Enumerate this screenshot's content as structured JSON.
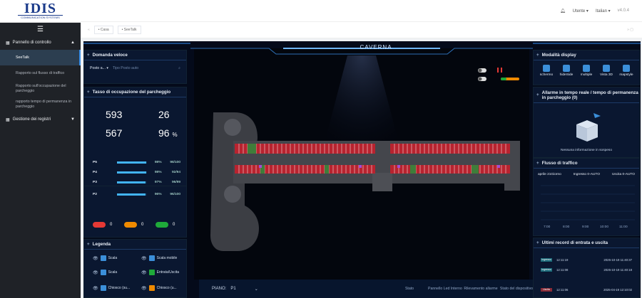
{
  "sidebar": {
    "logo_main": "IDIS",
    "logo_sub": "COMMUNICATION SYSTEMS",
    "menu_icon": "hamburger-icon",
    "group1": "Pannello di controllo",
    "items": [
      "SeeTalk",
      "Rapporto sul flusso di traffico",
      "Rapporto sull'occupazione del parcheggio",
      "rapporto tempo di permanenza in parcheggio"
    ],
    "group2": "Gestione dei registri"
  },
  "topbar": {
    "user": "Utente",
    "lang": "Italian",
    "version": "v4.0.4"
  },
  "tabs": {
    "home": "Casa",
    "seetalk": "SeeTalk"
  },
  "left": {
    "quick_title": "Domanda veloce",
    "quick_select": "Posto a...",
    "quick_placeholder": "Tipo Posto auto",
    "occ_title": "Tasso di occupazione del parcheggio",
    "n1": "593",
    "n2": "26",
    "n3": "567",
    "n4": "96",
    "n4_unit": "%",
    "rows": [
      {
        "label": "P5",
        "pct": "98%",
        "count": "98/100",
        "fill": 0.98
      },
      {
        "label": "P4",
        "pct": "98%",
        "count": "92/94",
        "fill": 0.98
      },
      {
        "label": "P3",
        "pct": "97%",
        "count": "96/99",
        "fill": 0.97
      },
      {
        "label": "P2",
        "pct": "96%",
        "count": "96/100",
        "fill": 0.96
      }
    ],
    "pill_red": "0",
    "pill_orange": "0",
    "pill_green": "0",
    "legend_title": "Legenda",
    "legend": [
      "Scala",
      "Scala mobile",
      "Scala",
      "Entrata/Uscita",
      "Chiosco (su...",
      "Chiosco (u..."
    ]
  },
  "center": {
    "title": "CAVERNA"
  },
  "bottom": {
    "floor_label": "PIANO:",
    "floor_value": "P1",
    "stato": "Stato",
    "col1": "Pannello Led Interno",
    "col2": "Rilevamento allarme",
    "col3": "Stato del dispositivo"
  },
  "right": {
    "mode_title": "Modalità display",
    "modes": [
      "schermo",
      "hideSide",
      "multiple",
      "Vista 3D",
      "mapstyle"
    ],
    "alarm_title": "Allarme in tempo reale / tempo di permanenza in parcheggio (0)",
    "no_info": "Nessuna informazione in sospeso",
    "flow_title": "Flusso di traffico",
    "flow_legend": [
      "aprile 21Giorno",
      "Ingresso 0-AUTO",
      "Uscita 0-AUTO"
    ],
    "flow_ticks": [
      "7:00",
      "8:00",
      "9:00",
      "10:00",
      "11:00"
    ],
    "records_title": "Ultimi record di entrata e uscita",
    "records": [
      {
        "tag": "Ingresso",
        "time": "12:11:19",
        "date": "2025-10-19 11:40:37"
      },
      {
        "tag": "Ingresso",
        "time": "12:11:08",
        "date": "2025-10-19 11:40:18"
      },
      {
        "tag": "Uscita",
        "time": "12:11:06",
        "date": "2025-04-19 12:10:02"
      }
    ]
  },
  "colors": {
    "accent": "#42b4f5",
    "red": "#e53935",
    "orange": "#ef8a00",
    "green": "#1faa3a",
    "slot_red": "#b8232f",
    "slot_green": "#3f7d3a"
  }
}
